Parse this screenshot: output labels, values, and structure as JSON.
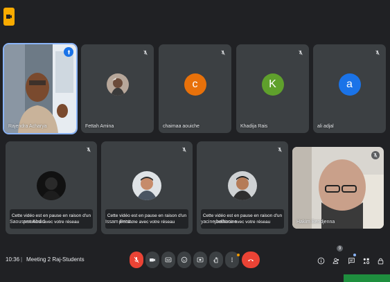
{
  "meeting": {
    "time": "10:36",
    "separator": "|",
    "title": "Meeting 2 Raj-Students"
  },
  "colors": {
    "background": "#202124",
    "tile": "#3c4043",
    "active_border": "#8ab4f8",
    "danger": "#ea4335",
    "accent_logo": "#f9ab00"
  },
  "tiles_row1": [
    {
      "name": "Rajendra Acharya",
      "type": "video",
      "pinned": true
    },
    {
      "name": "Fettah Amina",
      "type": "photo-avatar",
      "muted": true
    },
    {
      "name": "chaimaa aouiche",
      "type": "letter-avatar",
      "letter": "c",
      "color": "#e8710a",
      "muted": true
    },
    {
      "name": "Khadija Rais",
      "type": "letter-avatar",
      "letter": "K",
      "color": "#5fa02c",
      "muted": true
    },
    {
      "name": "ali adjal",
      "type": "letter-avatar",
      "letter": "a",
      "color": "#1a73e8",
      "muted": true
    }
  ],
  "tiles_row2": [
    {
      "name": "Saoussen Abdid",
      "type": "paused",
      "message_line1": "Cette vidéo est en pause en raison d'un",
      "message_line2": "problème avec votre réseau",
      "muted": true
    },
    {
      "name": "Issam Benz..",
      "type": "paused",
      "message_line1": "Cette vidéo est en pause en raison d'un",
      "message_line2": "problème avec votre réseau",
      "muted": true
    },
    {
      "name": "yacine belhocine",
      "type": "paused",
      "message_line1": "Cette vidéo est en pause en raison d'un",
      "message_line2": "problème avec votre réseau",
      "muted": true
    },
    {
      "name": "Hakim Bendjenna",
      "type": "video",
      "muted": true
    }
  ],
  "controls": [
    {
      "name": "mic-off-button",
      "icon": "mic-off-icon"
    },
    {
      "name": "camera-button",
      "icon": "camera-icon"
    },
    {
      "name": "captions-button",
      "icon": "captions-icon"
    },
    {
      "name": "emoji-button",
      "icon": "emoji-icon"
    },
    {
      "name": "present-button",
      "icon": "present-icon"
    },
    {
      "name": "raise-hand-button",
      "icon": "hand-icon"
    },
    {
      "name": "more-options-button",
      "icon": "more-icon"
    },
    {
      "name": "leave-call-button",
      "icon": "phone-hangup-icon"
    }
  ],
  "right_controls": {
    "people_count": "9"
  }
}
